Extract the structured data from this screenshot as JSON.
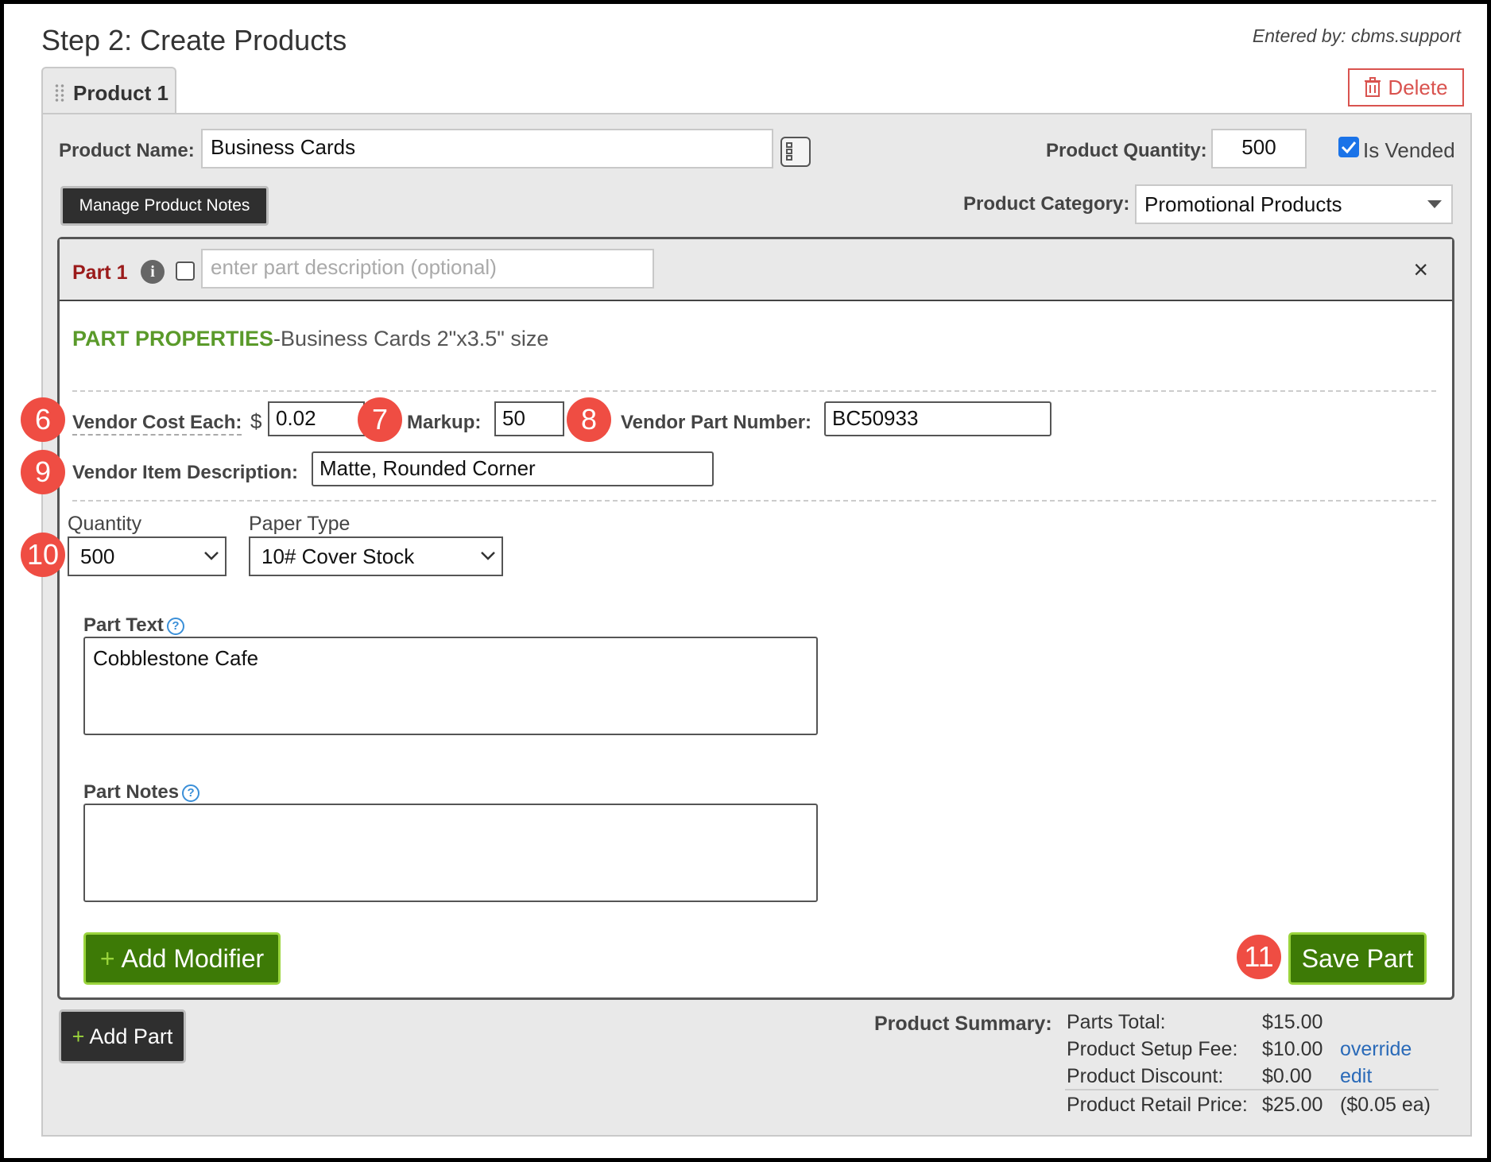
{
  "header": {
    "title": "Step 2: Create Products",
    "entered_by": "Entered by: cbms.support"
  },
  "product_tab": {
    "label": "Product 1",
    "delete_label": "Delete"
  },
  "product": {
    "name_label": "Product Name:",
    "name_value": "Business Cards",
    "quantity_label": "Product Quantity:",
    "quantity_value": "500",
    "is_vended_label": "Is Vended",
    "is_vended_checked": true,
    "manage_notes_label": "Manage Product Notes",
    "category_label": "Product Category:",
    "category_value": "Promotional Products"
  },
  "part": {
    "title": "Part 1",
    "description_placeholder": "enter part description (optional)",
    "properties_heading": "PART PROPERTIES",
    "properties_subtitle": "-Business Cards 2\"x3.5\" size",
    "vendor_cost_label": "Vendor Cost Each:",
    "currency": "$",
    "vendor_cost_value": "0.02",
    "markup_label": "Markup:",
    "markup_value": "50",
    "vendor_part_number_label": "Vendor Part Number:",
    "vendor_part_number_value": "BC50933",
    "vendor_item_desc_label": "Vendor Item Description:",
    "vendor_item_desc_value": "Matte, Rounded Corner",
    "quantity_label": "Quantity",
    "quantity_value": "500",
    "paper_type_label": "Paper Type",
    "paper_type_value": "10# Cover Stock",
    "part_text_label": "Part Text",
    "part_text_value": "Cobblestone Cafe",
    "part_notes_label": "Part Notes",
    "part_notes_value": "",
    "add_modifier_label": "Add Modifier",
    "save_part_label": "Save Part"
  },
  "callouts": {
    "c6": "6",
    "c7": "7",
    "c8": "8",
    "c9": "9",
    "c10": "10",
    "c11": "11"
  },
  "add_part_label": "Add Part",
  "summary": {
    "label": "Product Summary:",
    "parts_total_label": "Parts Total:",
    "parts_total_value": "$15.00",
    "setup_fee_label": "Product Setup Fee:",
    "setup_fee_value": "$10.00",
    "override_link": "override",
    "discount_label": "Product Discount:",
    "discount_value": "$0.00",
    "edit_link": "edit",
    "retail_label": "Product Retail Price:",
    "retail_value": "$25.00",
    "each_value": "($0.05 ea)"
  },
  "colors": {
    "accent_green": "#3d7a06",
    "heading_green": "#5a9a2a",
    "part_red": "#9b1b1b",
    "callout_red": "#ef4d43",
    "delete_red": "#d9534f",
    "link_blue": "#2a6ab8"
  },
  "icons": [
    "grip-icon",
    "trash-icon",
    "list-icon",
    "info-icon",
    "close-icon",
    "chevron-down-icon",
    "help-icon",
    "plus-icon"
  ]
}
